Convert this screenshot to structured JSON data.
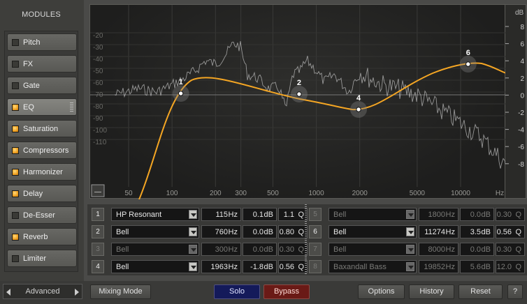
{
  "modules": {
    "title": "MODULES",
    "items": [
      {
        "label": "Pitch",
        "on": false,
        "active": false
      },
      {
        "label": "FX",
        "on": false,
        "active": false
      },
      {
        "label": "Gate",
        "on": false,
        "active": false
      },
      {
        "label": "EQ",
        "on": true,
        "active": true
      },
      {
        "label": "Saturation",
        "on": true,
        "active": false
      },
      {
        "label": "Compressors",
        "on": true,
        "active": false
      },
      {
        "label": "Harmonizer",
        "on": true,
        "active": false
      },
      {
        "label": "Delay",
        "on": true,
        "active": false
      },
      {
        "label": "De-Esser",
        "on": false,
        "active": false
      },
      {
        "label": "Reverb",
        "on": true,
        "active": false
      },
      {
        "label": "Limiter",
        "on": false,
        "active": false
      }
    ],
    "advanced_label": "Advanced"
  },
  "graph": {
    "x_ticks": [
      "50",
      "100",
      "200",
      "300",
      "500",
      "1000",
      "2000",
      "5000",
      "10000",
      "Hz"
    ],
    "left_db_ticks": [
      "-20",
      "-30",
      "-40",
      "-50",
      "-60",
      "-70",
      "-80",
      "-90",
      "-100",
      "-110"
    ],
    "right_db_unit": "dB",
    "right_db_ticks": [
      "8",
      "6",
      "4",
      "2",
      "0",
      "-2",
      "-4",
      "-6",
      "-8"
    ],
    "collapse_button": "—",
    "node_labels": [
      "1",
      "2",
      "4",
      "6"
    ]
  },
  "bands": [
    {
      "num": "1",
      "type": "HP Resonant",
      "freq": "115",
      "freq_unit": "Hz",
      "gain": "0.1",
      "gain_unit": "dB",
      "q": "1.1",
      "q_unit": "Q",
      "enabled": true
    },
    {
      "num": "2",
      "type": "Bell",
      "freq": "760",
      "freq_unit": "Hz",
      "gain": "0.0",
      "gain_unit": "dB",
      "q": "0.80",
      "q_unit": "Q",
      "enabled": true
    },
    {
      "num": "3",
      "type": "Bell",
      "freq": "300",
      "freq_unit": "Hz",
      "gain": "0.0",
      "gain_unit": "dB",
      "q": "0.30",
      "q_unit": "Q",
      "enabled": false
    },
    {
      "num": "4",
      "type": "Bell",
      "freq": "1963",
      "freq_unit": "Hz",
      "gain": "-1.8",
      "gain_unit": "dB",
      "q": "0.56",
      "q_unit": "Q",
      "enabled": true
    },
    {
      "num": "5",
      "type": "Bell",
      "freq": "1800",
      "freq_unit": "Hz",
      "gain": "0.0",
      "gain_unit": "dB",
      "q": "0.30",
      "q_unit": "Q",
      "enabled": false
    },
    {
      "num": "6",
      "type": "Bell",
      "freq": "11274",
      "freq_unit": "Hz",
      "gain": "3.5",
      "gain_unit": "dB",
      "q": "0.56",
      "q_unit": "Q",
      "enabled": true
    },
    {
      "num": "7",
      "type": "Bell",
      "freq": "8000",
      "freq_unit": "Hz",
      "gain": "0.0",
      "gain_unit": "dB",
      "q": "0.30",
      "q_unit": "Q",
      "enabled": false
    },
    {
      "num": "8",
      "type": "Baxandall Bass",
      "freq": "19852",
      "freq_unit": "Hz",
      "gain": "5.6",
      "gain_unit": "dB",
      "q": "12.0",
      "q_unit": "Q",
      "enabled": false
    }
  ],
  "toolbar": {
    "mixing_mode": "Mixing Mode",
    "solo": "Solo",
    "bypass": "Bypass",
    "options": "Options",
    "history": "History",
    "reset": "Reset",
    "help": "?"
  },
  "colors": {
    "eq_curve": "#f5a623",
    "spectrum": "#bdbdbd",
    "led_on": "#f0a020",
    "solo_bg": "#141a5a",
    "bypass_bg": "#6a1a16"
  }
}
